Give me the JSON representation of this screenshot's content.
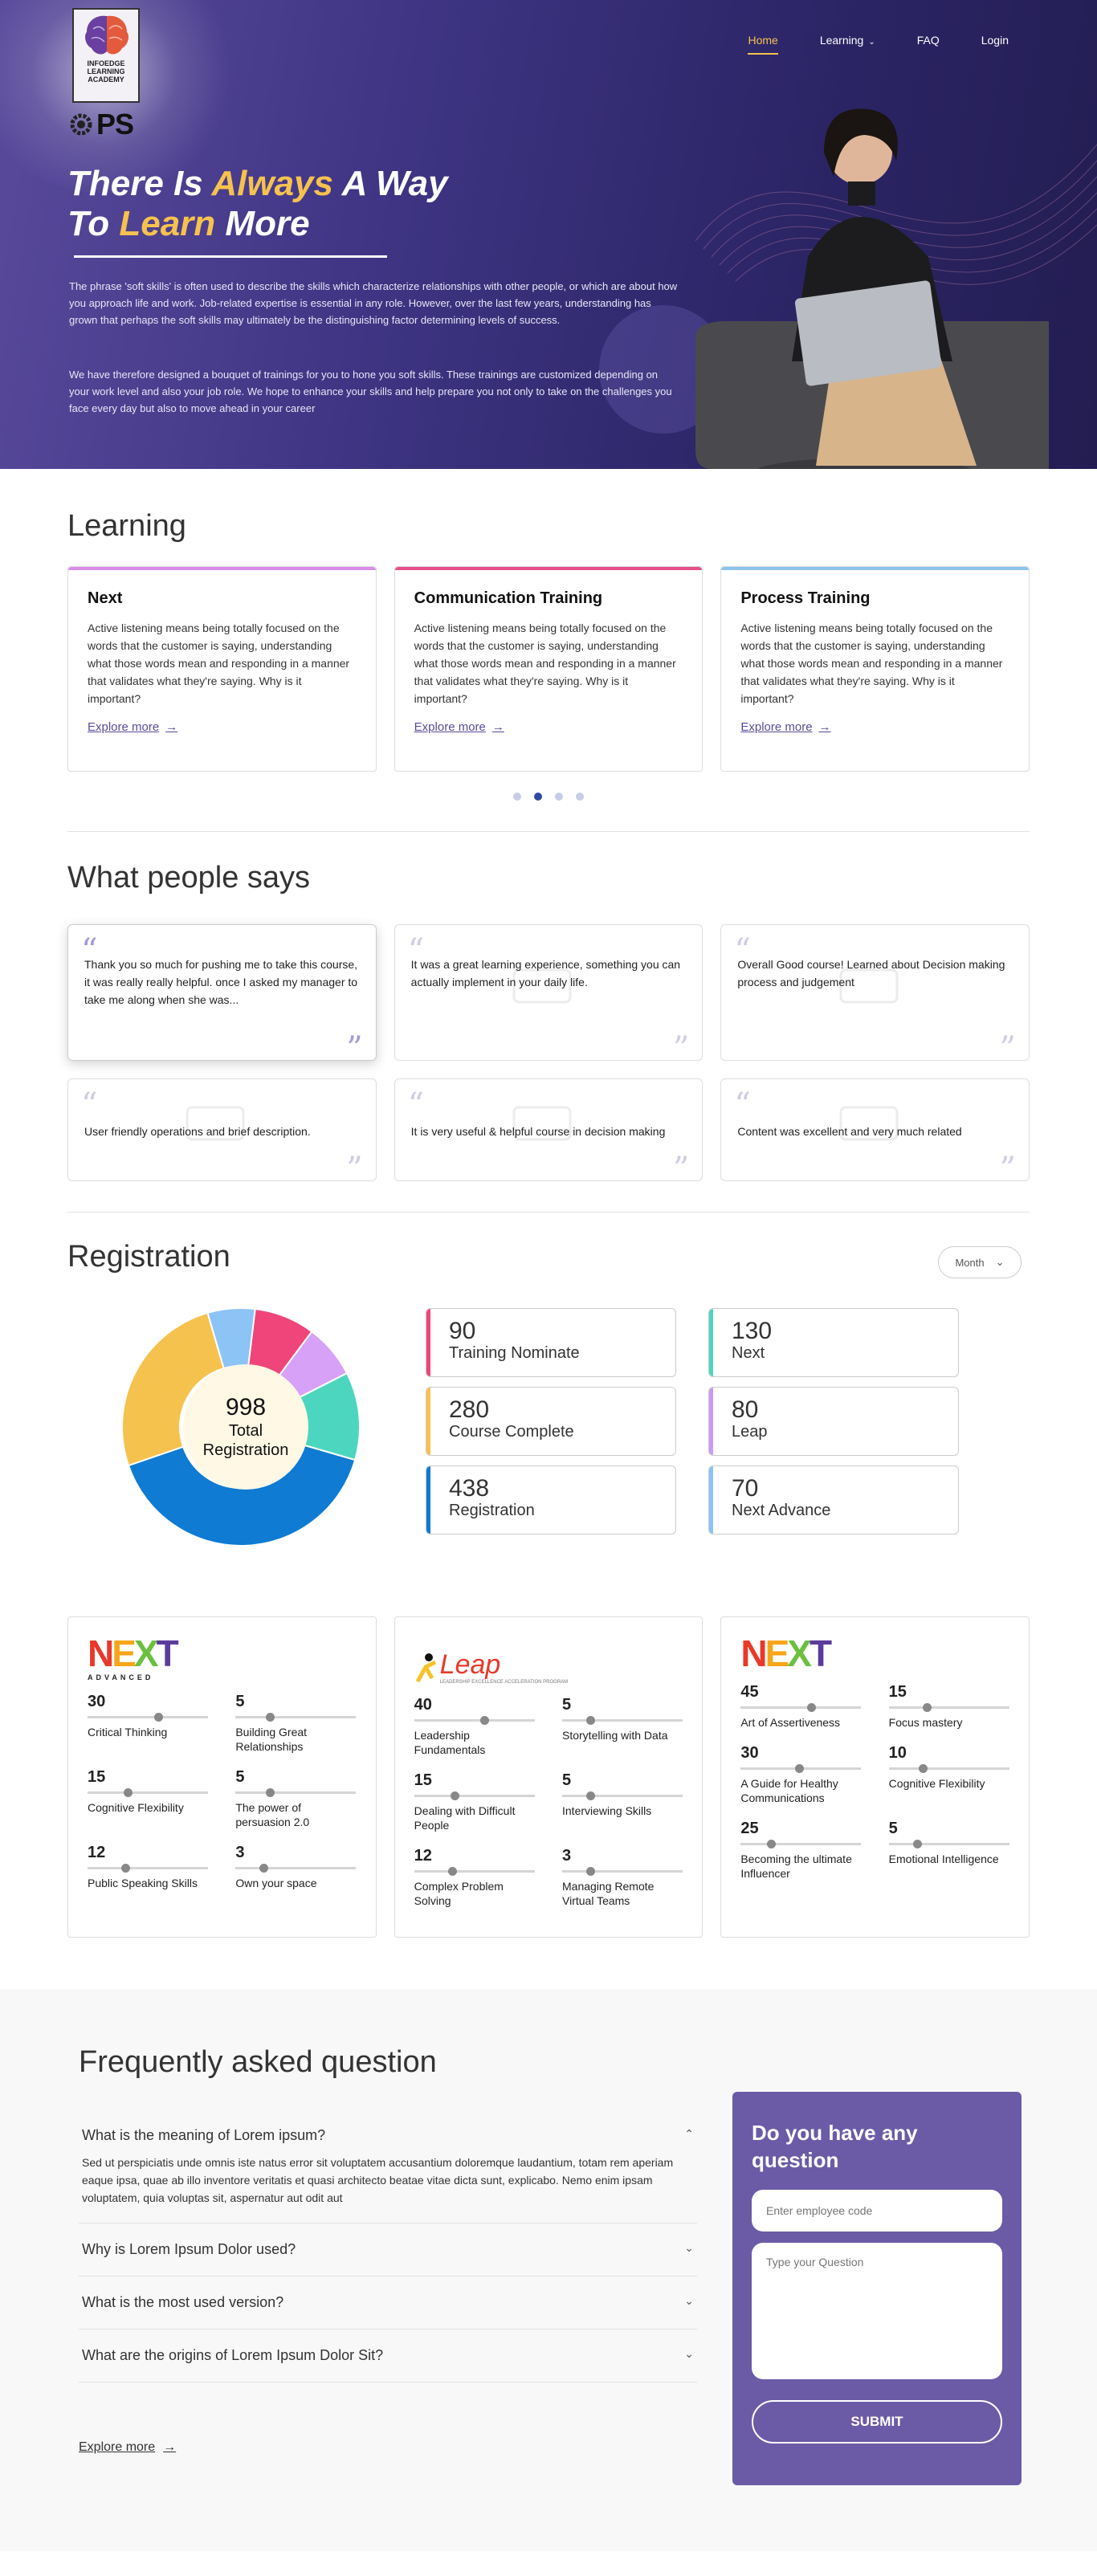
{
  "brand": {
    "logo_text": "INFOEDGE LEARNING ACADEMY",
    "ops": "PS"
  },
  "nav": {
    "items": [
      {
        "label": "Home"
      },
      {
        "label": "Learning"
      },
      {
        "label": "FAQ"
      },
      {
        "label": "Login"
      }
    ],
    "active": "Home"
  },
  "hero": {
    "title_line1_a": "There Is ",
    "title_line1_b": "Always",
    "title_line1_c": " A Way",
    "title_line2_a": "To ",
    "title_line2_b": "Learn",
    "title_line2_c": " More",
    "para1": "The phrase 'soft skills' is often used to describe the skills which characterize relationships with other people, or which are about how you approach life and work. Job-related expertise is essential in any role. However, over the last few years, understanding has grown that perhaps the soft skills may ultimately be the distinguishing factor determining levels of success.",
    "para2": "We have therefore designed a bouquet of trainings for you to hone you soft skills. These trainings are customized depending on your work level and also your job role. We hope to enhance your skills and help prepare you not only to take on the challenges you face every day but also to move ahead in your career"
  },
  "learning": {
    "title": "Learning",
    "cards": [
      {
        "title": "Next",
        "text": "Active listening means being totally focused on the words that the customer is saying, understanding what those words mean and responding in a manner that validates what they're saying. Why is it important?",
        "link": "Explore more",
        "color": "#d98ce8"
      },
      {
        "title": "Communication Training",
        "text": "Active listening means being totally focused on the words that the customer is saying, understanding what those words mean and responding in a manner that validates what they're saying. Why is it important?",
        "link": "Explore more",
        "color": "#e6508a"
      },
      {
        "title": "Process Training",
        "text": "Active listening means being totally focused on the words that the customer is saying, understanding what those words mean and responding in a manner that validates what they're saying. Why is it important?",
        "link": "Explore more",
        "color": "#8cc4ee"
      }
    ],
    "pager_active": 2,
    "pager_count": 4
  },
  "people": {
    "title": "What people says",
    "testimonials": [
      "Thank you so much for pushing me to take this course, it was really really helpful. once I asked my manager to take me along when she was...",
      "It was a great learning experience, something you can actually implement in your daily life.",
      "Overall Good course! Learned about Decision making process and judgement",
      "User friendly  operations and brief description.",
      "It is very useful  & helpful  course in decision making",
      "Content was excellent and very much related"
    ]
  },
  "registration": {
    "title": "Registration",
    "filter": "Month",
    "total_value": "998",
    "total_label_1": "Total",
    "total_label_2": "Registration",
    "stats": [
      {
        "value": "90",
        "label": "Training Nominate",
        "color": "#f0457a"
      },
      {
        "value": "130",
        "label": "Next",
        "color": "#4dd6bf"
      },
      {
        "value": "280",
        "label": "Course Complete",
        "color": "#f6c24e"
      },
      {
        "value": "80",
        "label": "Leap",
        "color": "#c99af5"
      },
      {
        "value": "438",
        "label": "Registration",
        "color": "#0f7bd2"
      },
      {
        "value": "70",
        "label": "Next Advance",
        "color": "#8cc4f5"
      }
    ]
  },
  "chart_data": {
    "type": "pie",
    "title": "998 Total Registration",
    "categories": [
      "Training Nominate",
      "Leap",
      "Next",
      "Registration",
      "Course Complete",
      "Next Advance"
    ],
    "values": [
      90,
      80,
      130,
      438,
      280,
      70
    ],
    "colors": [
      "#f0457a",
      "#d7a1f7",
      "#4dd6bf",
      "#0f7bd2",
      "#f6c24e",
      "#8cc4f5"
    ]
  },
  "levels": [
    {
      "logo": "NEXT",
      "logo_sub": "ADVANCED",
      "skills": [
        {
          "value": "30",
          "name": "Critical Thinking",
          "pct": 0.55
        },
        {
          "value": "5",
          "name": "Building Great Relationships",
          "pct": 0.25
        },
        {
          "value": "15",
          "name": "Cognitive Flexibility",
          "pct": 0.3
        },
        {
          "value": "5",
          "name": "The power of persuasion 2.0",
          "pct": 0.25
        },
        {
          "value": "12",
          "name": "Public Speaking Skills",
          "pct": 0.28
        },
        {
          "value": "3",
          "name": "Own your space",
          "pct": 0.2
        }
      ]
    },
    {
      "logo": "Leap",
      "logo_sub": "LEADERSHIP EXCELLENCE ACCELERATION PROGRAM",
      "skills": [
        {
          "value": "40",
          "name": "Leadership Fundamentals",
          "pct": 0.55
        },
        {
          "value": "5",
          "name": "Storytelling with Data",
          "pct": 0.2
        },
        {
          "value": "15",
          "name": "Dealing with Difficult People",
          "pct": 0.3
        },
        {
          "value": "5",
          "name": "Interviewing Skills",
          "pct": 0.2
        },
        {
          "value": "12",
          "name": "Complex Problem Solving",
          "pct": 0.28
        },
        {
          "value": "3",
          "name": "Managing Remote Virtual Teams",
          "pct": 0.2
        }
      ]
    },
    {
      "logo": "NEXT",
      "logo_sub": "",
      "skills": [
        {
          "value": "45",
          "name": "Art of Assertiveness",
          "pct": 0.55
        },
        {
          "value": "15",
          "name": "Focus mastery",
          "pct": 0.28
        },
        {
          "value": "30",
          "name": "A Guide for Healthy Communications",
          "pct": 0.45
        },
        {
          "value": "10",
          "name": "Cognitive Flexibility",
          "pct": 0.25
        },
        {
          "value": "25",
          "name": "Becoming the ultimate Influencer",
          "pct": 0.22
        },
        {
          "value": "5",
          "name": "Emotional Intelligence",
          "pct": 0.2
        }
      ]
    }
  ],
  "faq": {
    "title": "Frequently asked question",
    "items": [
      {
        "q": "What is the meaning of Lorem ipsum?",
        "a": "Sed ut perspiciatis unde omnis iste natus error sit voluptatem accusantium doloremque laudantium, totam rem aperiam eaque ipsa, quae ab illo inventore veritatis et quasi architecto beatae vitae dicta sunt, explicabo. Nemo enim ipsam voluptatem, quia voluptas sit, aspernatur aut odit aut"
      },
      {
        "q": "Why is Lorem Ipsum Dolor used?"
      },
      {
        "q": "What is the most used version?"
      },
      {
        "q": "What are the origins of Lorem Ipsum Dolor Sit?"
      }
    ],
    "more": "Explore more"
  },
  "question_form": {
    "title": "Do you have any question",
    "code_placeholder": "Enter employee code",
    "question_placeholder": "Type your Question",
    "submit": "SUBMIT"
  }
}
